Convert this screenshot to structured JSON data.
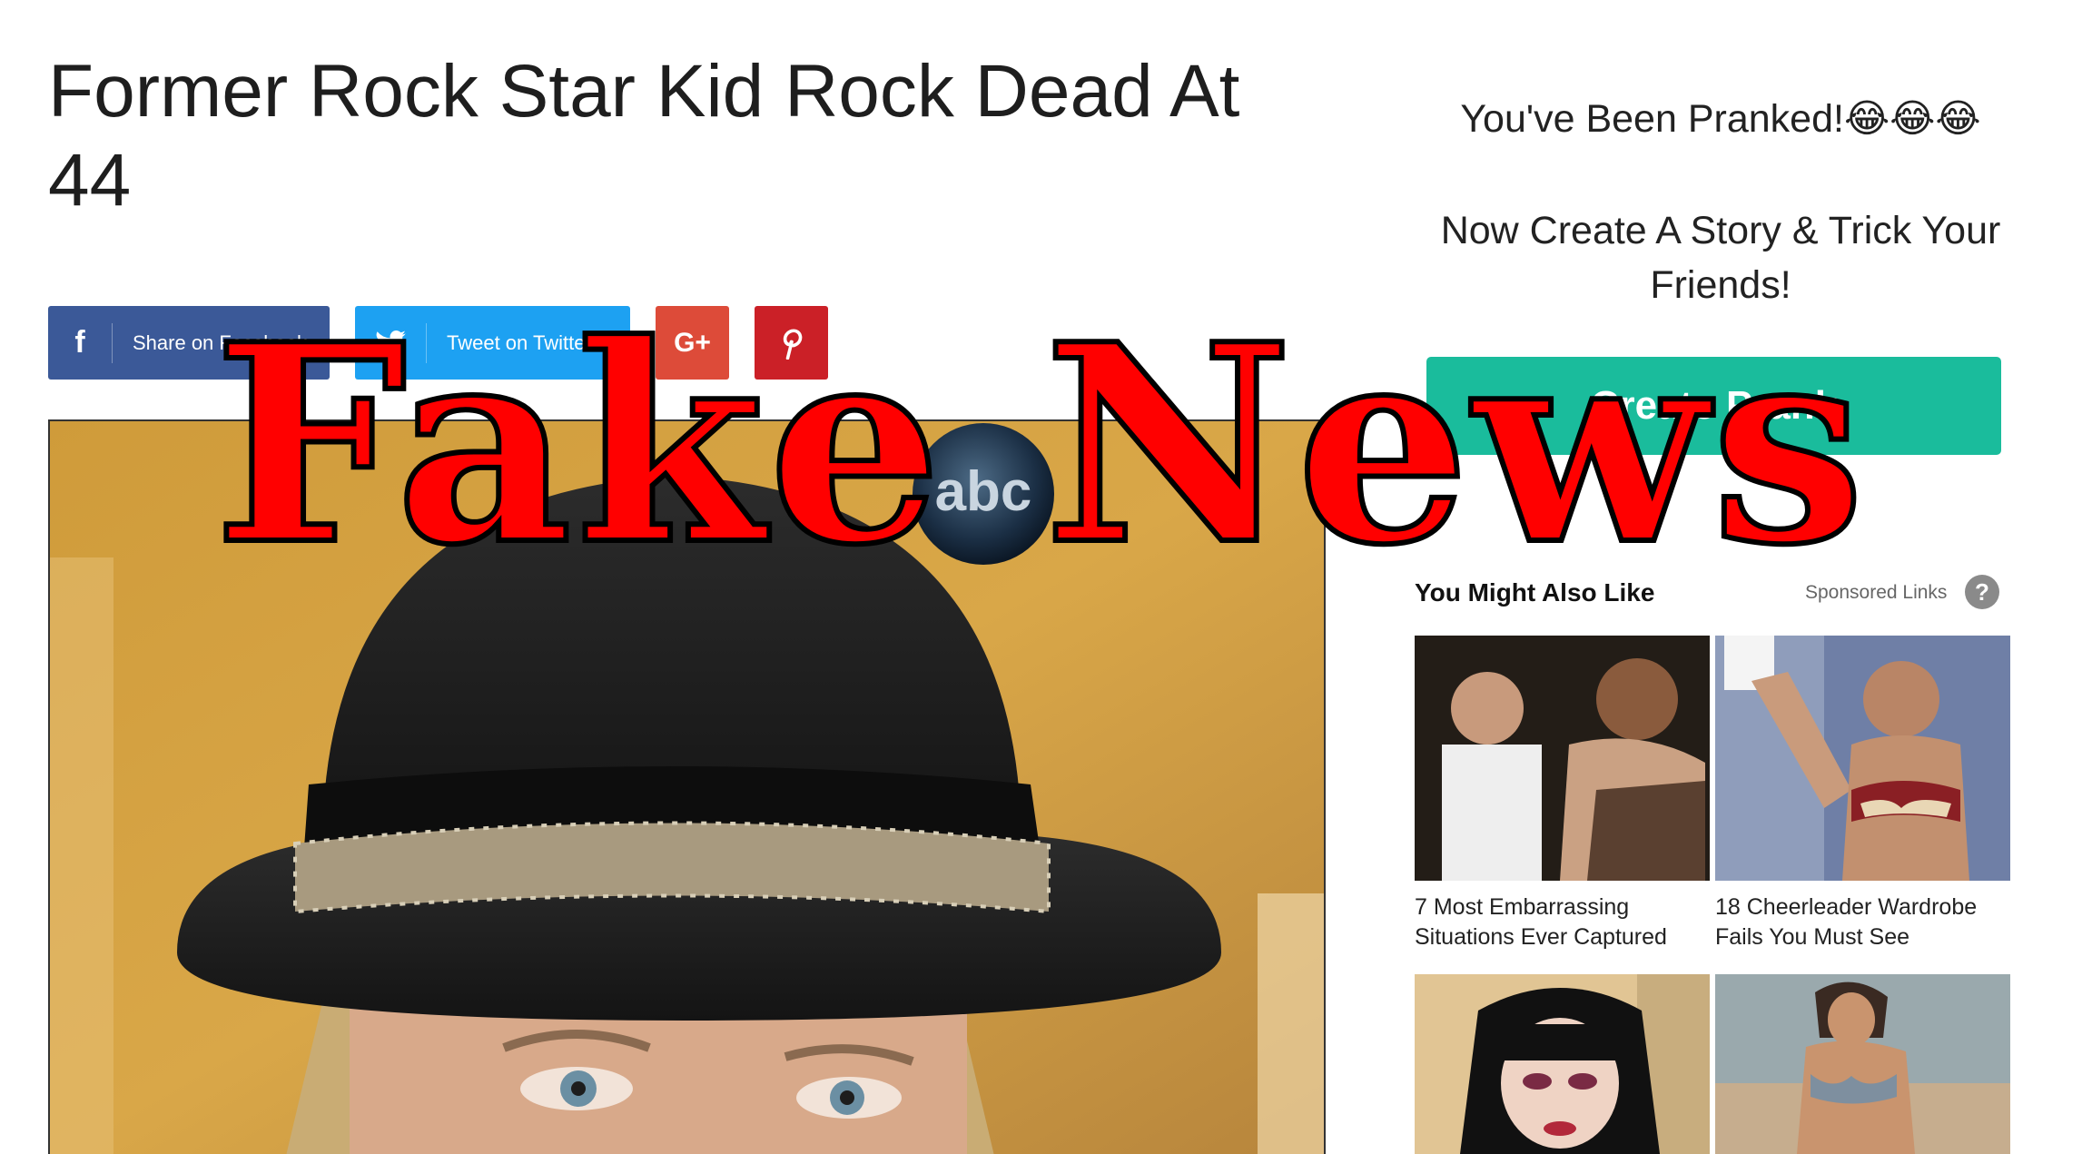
{
  "article": {
    "title": "Former Rock Star Kid Rock Dead At 44"
  },
  "share_buttons": {
    "facebook_icon": "f",
    "facebook_label": "Share on Facebook",
    "twitter_label": "Tweet on Twitter",
    "googleplus_icon": "G+",
    "pinterest_icon": "P"
  },
  "sidebar": {
    "pranked_text": "You've Been Pranked!😂😂😂",
    "create_story_text": "Now Create A Story & Trick Your Friends!",
    "create_button_label": "Create Prank",
    "you_might_also_like": "You Might Also Like",
    "sponsored_label": "Sponsored Links",
    "help_icon": "?",
    "items": [
      {
        "caption": "7 Most Embarrassing Situations Ever Captured"
      },
      {
        "caption": "18 Cheerleader Wardrobe Fails You Must See"
      },
      {
        "caption": ""
      },
      {
        "caption": ""
      }
    ]
  },
  "photo": {
    "badge_text": "abc"
  },
  "overlay": {
    "stamp_text": "Fake News"
  },
  "colors": {
    "facebook": "#3b5998",
    "twitter": "#1da1f2",
    "googleplus": "#dd4b39",
    "pinterest": "#cb2027",
    "create_button": "#1abc9c",
    "stamp": "#ff0000"
  }
}
